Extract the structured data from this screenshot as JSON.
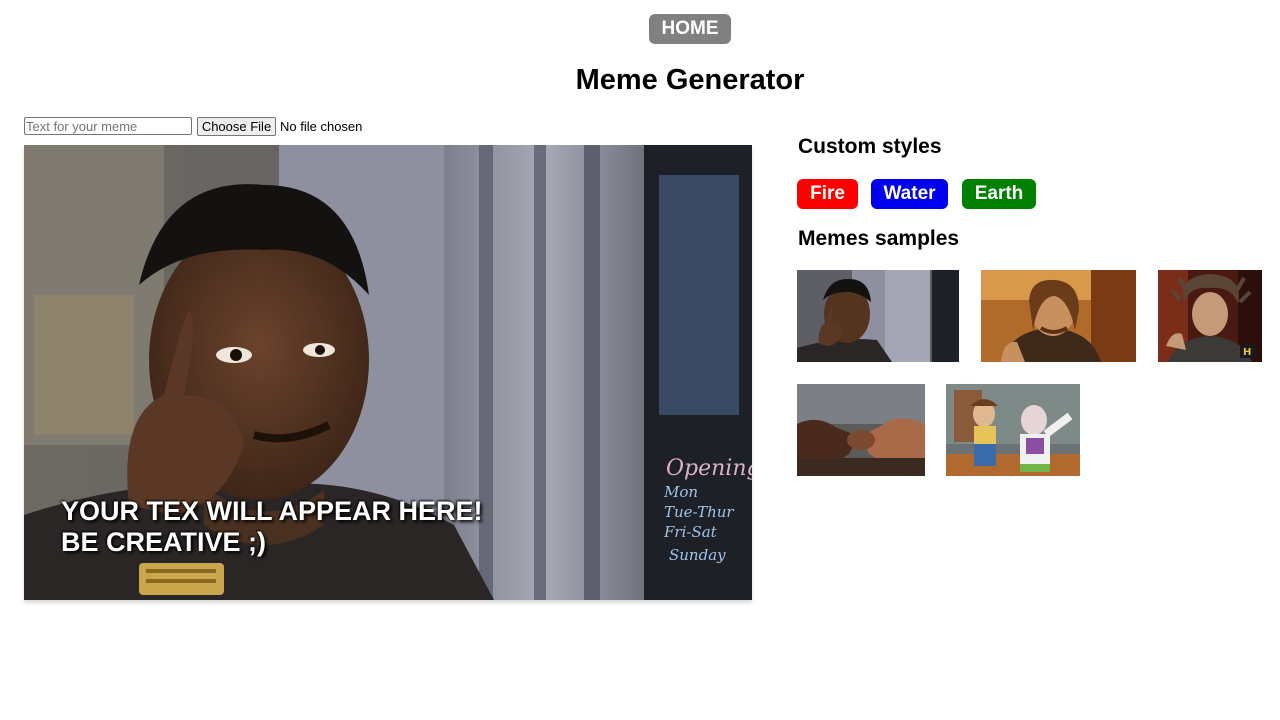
{
  "nav": {
    "home_label": "HOME"
  },
  "page": {
    "title": "Meme Generator"
  },
  "editor": {
    "text_placeholder": "Text for your meme",
    "text_value": "",
    "file_button_label": "Choose File",
    "file_status": "No file chosen",
    "caption_line1": "YOUR TEX WILL APPEAR HERE!",
    "caption_line2": "BE CREATIVE ;)",
    "current_meme": "roll-safe"
  },
  "custom_styles": {
    "heading": "Custom styles",
    "buttons": [
      {
        "label": "Fire",
        "color": "#ff0000"
      },
      {
        "label": "Water",
        "color": "#0000ee"
      },
      {
        "label": "Earth",
        "color": "#008000"
      }
    ]
  },
  "samples": {
    "heading": "Memes samples",
    "items": [
      "roll-safe",
      "one-does-not-simply",
      "ancient-aliens",
      "epic-handshake",
      "x-everywhere"
    ]
  }
}
